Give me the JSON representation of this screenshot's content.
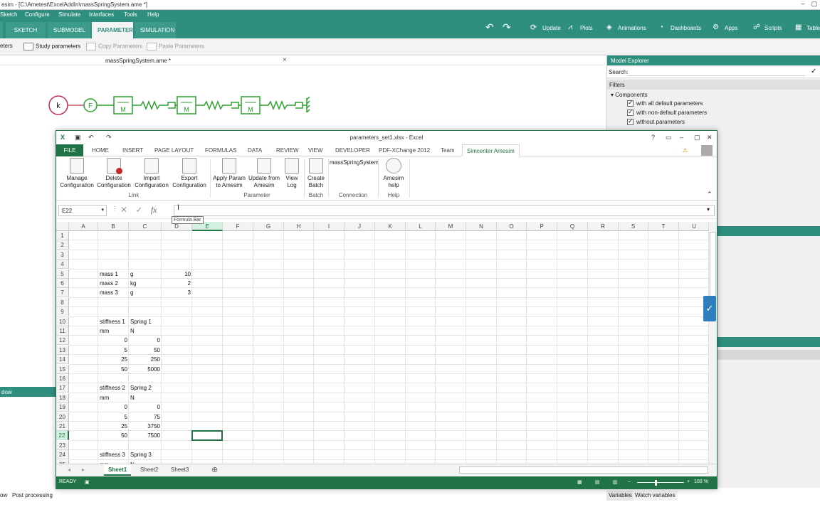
{
  "amesim": {
    "title": "esim - [C:\\Ametest\\ExcelAddIn\\massSpringSystem.ame *]",
    "menu": [
      "Sketch",
      "Configure",
      "Simulate",
      "Interfaces",
      "Tools",
      "Help"
    ],
    "tabs": [
      "SKETCH",
      "SUBMODEL",
      "PARAMETER",
      "SIMULATION"
    ],
    "active_tab": "PARAMETER",
    "ribbon_right": [
      "Update",
      "Plots",
      "Animations",
      "Dashboards",
      "Apps",
      "Scripts",
      "Table"
    ],
    "toolbar": {
      "parameters": "eters",
      "study": "Study parameters",
      "copy": "Copy Parameters",
      "paste": "Paste Parameters"
    },
    "doc_tab": "massSpringSystem.ame *",
    "diagram": {
      "source": "k",
      "force": "F",
      "mass": "M"
    },
    "left_band": "dow",
    "bottom": {
      "post_processing": "Post processing",
      "left_stub": "ow",
      "variables": "Variables",
      "watch_variables": "Watch variables"
    }
  },
  "explorer": {
    "title": "Model Explorer",
    "search_label": "Search:",
    "filters": "Filters",
    "components": "Components",
    "options": [
      "with all default parameters",
      "with non-default parameters",
      "without parameters"
    ]
  },
  "excel": {
    "title": "parameters_set1.xlsx - Excel",
    "tabs": [
      "FILE",
      "HOME",
      "INSERT",
      "PAGE LAYOUT",
      "FORMULAS",
      "DATA",
      "REVIEW",
      "VIEW",
      "DEVELOPER",
      "PDF-XChange 2012",
      "Team",
      "Simcenter Amesim"
    ],
    "active_tab": "Simcenter Amesim",
    "ribbon": {
      "manage": [
        "Manage",
        "Configuration"
      ],
      "delete": [
        "Delete",
        "Configuration"
      ],
      "import": [
        "Import",
        "Configuration"
      ],
      "export": [
        "Export",
        "Configuration"
      ],
      "apply": [
        "Apply Param",
        "to Amesim"
      ],
      "update": [
        "Update from",
        "Amesim"
      ],
      "viewlog": [
        "View",
        "Log"
      ],
      "batch": [
        "Create",
        "Batch"
      ],
      "connection_value": "massSpringSystem",
      "help": [
        "Amesim",
        "help"
      ],
      "groups": {
        "link": "Link",
        "parameter": "Parameter",
        "batch": "Batch",
        "connection": "Connection",
        "help": "Help"
      }
    },
    "namebox": "E22",
    "fx": "fx",
    "tooltip": "Formula Bar",
    "columns": [
      "A",
      "B",
      "C",
      "D",
      "E",
      "F",
      "G",
      "H",
      "I",
      "J",
      "K",
      "L",
      "M",
      "N",
      "O",
      "P",
      "Q",
      "R",
      "S",
      "T",
      "U"
    ],
    "selected_column": "E",
    "selected_row": "22",
    "rows": [
      "1",
      "2",
      "3",
      "4",
      "5",
      "6",
      "7",
      "8",
      "9",
      "10",
      "11",
      "12",
      "13",
      "14",
      "15",
      "16",
      "17",
      "18",
      "19",
      "20",
      "21",
      "22",
      "23",
      "24",
      "25"
    ],
    "cells": [
      {
        "row": 5,
        "col": "B",
        "v": "mass 1"
      },
      {
        "row": 5,
        "col": "C",
        "v": "g"
      },
      {
        "row": 5,
        "col": "D",
        "v": "10",
        "num": true
      },
      {
        "row": 6,
        "col": "B",
        "v": "mass 2"
      },
      {
        "row": 6,
        "col": "C",
        "v": "kg"
      },
      {
        "row": 6,
        "col": "D",
        "v": "2",
        "num": true
      },
      {
        "row": 7,
        "col": "B",
        "v": "mass 3"
      },
      {
        "row": 7,
        "col": "C",
        "v": "g"
      },
      {
        "row": 7,
        "col": "D",
        "v": "3",
        "num": true
      },
      {
        "row": 10,
        "col": "B",
        "v": "stiffness 1"
      },
      {
        "row": 10,
        "col": "C",
        "v": "Spring 1"
      },
      {
        "row": 11,
        "col": "B",
        "v": "mm"
      },
      {
        "row": 11,
        "col": "C",
        "v": "N"
      },
      {
        "row": 12,
        "col": "B",
        "v": "0",
        "num": true
      },
      {
        "row": 12,
        "col": "C",
        "v": "0",
        "num": true
      },
      {
        "row": 13,
        "col": "B",
        "v": "5",
        "num": true
      },
      {
        "row": 13,
        "col": "C",
        "v": "50",
        "num": true
      },
      {
        "row": 14,
        "col": "B",
        "v": "25",
        "num": true
      },
      {
        "row": 14,
        "col": "C",
        "v": "250",
        "num": true
      },
      {
        "row": 15,
        "col": "B",
        "v": "50",
        "num": true
      },
      {
        "row": 15,
        "col": "C",
        "v": "5000",
        "num": true
      },
      {
        "row": 17,
        "col": "B",
        "v": "stiffness 2"
      },
      {
        "row": 17,
        "col": "C",
        "v": "Spring 2"
      },
      {
        "row": 18,
        "col": "B",
        "v": "mm"
      },
      {
        "row": 18,
        "col": "C",
        "v": "N"
      },
      {
        "row": 19,
        "col": "B",
        "v": "0",
        "num": true
      },
      {
        "row": 19,
        "col": "C",
        "v": "0",
        "num": true
      },
      {
        "row": 20,
        "col": "B",
        "v": "5",
        "num": true
      },
      {
        "row": 20,
        "col": "C",
        "v": "75",
        "num": true
      },
      {
        "row": 21,
        "col": "B",
        "v": "25",
        "num": true
      },
      {
        "row": 21,
        "col": "C",
        "v": "3750",
        "num": true
      },
      {
        "row": 22,
        "col": "B",
        "v": "50",
        "num": true
      },
      {
        "row": 22,
        "col": "C",
        "v": "7500",
        "num": true
      },
      {
        "row": 24,
        "col": "B",
        "v": "stiffness 3"
      },
      {
        "row": 24,
        "col": "C",
        "v": "Spring 3"
      },
      {
        "row": 25,
        "col": "B",
        "v": "mm"
      },
      {
        "row": 25,
        "col": "C",
        "v": "N"
      }
    ],
    "sheets": [
      "Sheet1",
      "Sheet2",
      "Sheet3"
    ],
    "active_sheet": "Sheet1",
    "status": "READY",
    "zoom": "100 %"
  },
  "colors": {
    "amesim_teal": "#2f8f7f",
    "excel_green": "#217346"
  }
}
